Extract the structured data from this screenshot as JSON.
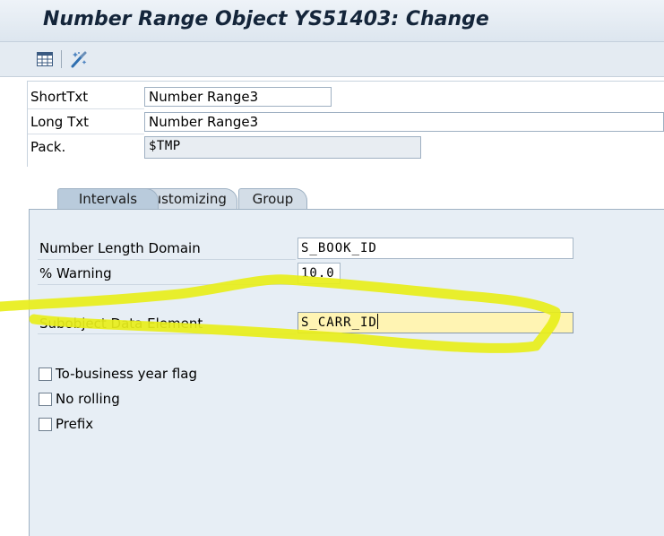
{
  "title": "Number Range Object YS51403: Change",
  "toolbar": {
    "buttons": [
      {
        "icon": "table-icon"
      },
      {
        "icon": "settings-wand-icon"
      }
    ]
  },
  "header": {
    "short_text": {
      "label": "ShortTxt",
      "value": "Number Range3"
    },
    "long_text": {
      "label": "Long Txt",
      "value": "Number Range3"
    },
    "package": {
      "label": "Pack.",
      "value": "$TMP"
    }
  },
  "tabs": [
    {
      "label": "Intervals",
      "active": true
    },
    {
      "label": "Customizing",
      "active": false
    },
    {
      "label": "Group",
      "active": false
    }
  ],
  "intervals": {
    "number_length_domain": {
      "label": "Number Length Domain",
      "value": "S_BOOK_ID"
    },
    "warning": {
      "label": "% Warning",
      "value": "10.0"
    },
    "subobject_data_element": {
      "label": "Subobject Data Element",
      "value": "S_CARR_ID"
    },
    "checkboxes": [
      {
        "label": "To-business year flag",
        "checked": false
      },
      {
        "label": "No rolling",
        "checked": false
      },
      {
        "label": "Prefix",
        "checked": false
      }
    ]
  },
  "colors": {
    "highlight_marker": "#e8ee1a",
    "title_text": "#14253a",
    "panel_bg": "#e7eef5"
  }
}
